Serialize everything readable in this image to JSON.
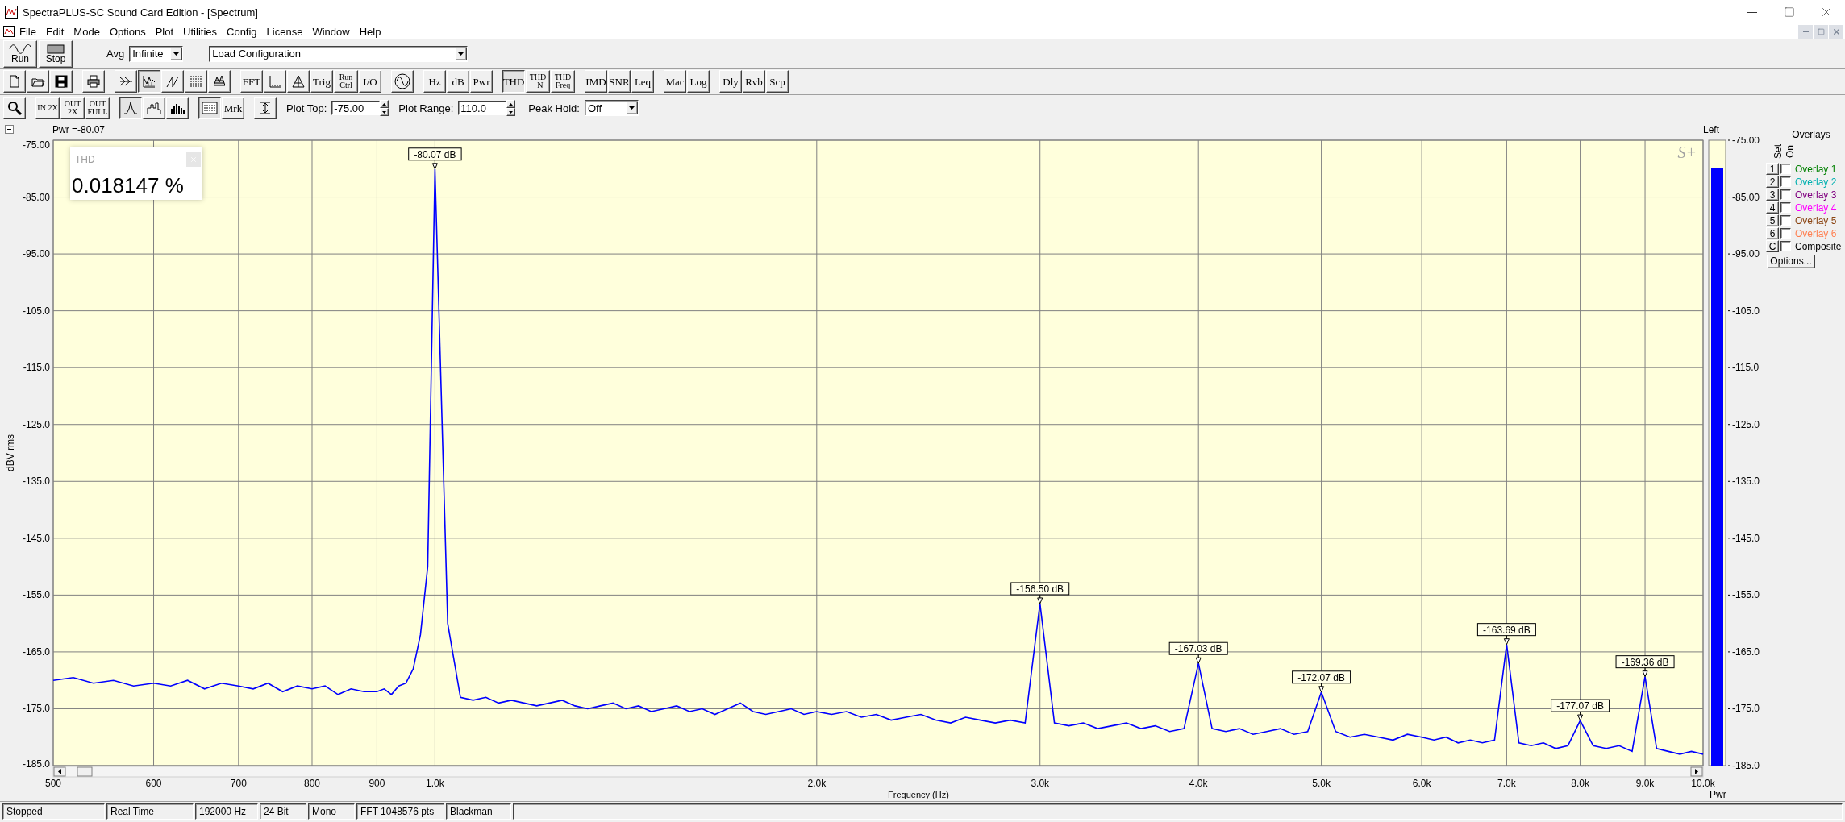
{
  "window": {
    "title": "SpectraPLUS-SC Sound Card Edition - [Spectrum]"
  },
  "menu": [
    "File",
    "Edit",
    "Mode",
    "Options",
    "Plot",
    "Utilities",
    "Config",
    "License",
    "Window",
    "Help"
  ],
  "toolbar_main": {
    "run": "Run",
    "stop": "Stop",
    "avg_label": "Avg",
    "avg_value": "Infinite",
    "config_value": "Load Configuration"
  },
  "toolbar_analysis": [
    [
      {
        "kind": "icon",
        "pressed": false
      },
      {
        "kind": "icon",
        "pressed": false
      },
      {
        "kind": "icon",
        "pressed": false
      }
    ],
    [
      {
        "kind": "icon",
        "pressed": false
      }
    ],
    [
      {
        "kind": "icon",
        "pressed": false
      },
      {
        "kind": "icon",
        "pressed": true
      },
      {
        "kind": "icon",
        "pressed": false
      },
      {
        "kind": "icon",
        "pressed": false
      },
      {
        "kind": "icon",
        "pressed": false
      }
    ],
    [
      {
        "kind": "text",
        "label": "FFT",
        "pressed": false
      },
      {
        "kind": "icon",
        "pressed": false
      },
      {
        "kind": "icon",
        "pressed": false
      },
      {
        "kind": "text",
        "label": "Trig",
        "pressed": false
      },
      {
        "kind": "text",
        "label": "Run Ctrl",
        "pressed": false
      },
      {
        "kind": "text",
        "label": "I/O",
        "pressed": false
      }
    ],
    [
      {
        "kind": "icon",
        "pressed": false
      }
    ],
    [
      {
        "kind": "text",
        "label": "Hz",
        "pressed": false
      },
      {
        "kind": "text",
        "label": "dB",
        "pressed": false
      },
      {
        "kind": "text",
        "label": "Pwr",
        "pressed": false
      }
    ],
    [
      {
        "kind": "text",
        "label": "THD",
        "pressed": true
      },
      {
        "kind": "text",
        "label": "THD +N",
        "pressed": false
      },
      {
        "kind": "text",
        "label": "THD Freq",
        "pressed": false
      }
    ],
    [
      {
        "kind": "text",
        "label": "IMD",
        "pressed": false
      },
      {
        "kind": "text",
        "label": "SNR",
        "pressed": false
      },
      {
        "kind": "text",
        "label": "Leq",
        "pressed": false
      }
    ],
    [
      {
        "kind": "text",
        "label": "Mac",
        "pressed": false
      },
      {
        "kind": "text",
        "label": "Log",
        "pressed": false
      }
    ],
    [
      {
        "kind": "text",
        "label": "Dly",
        "pressed": false
      },
      {
        "kind": "text",
        "label": "Rvb",
        "pressed": false
      },
      {
        "kind": "text",
        "label": "Scp",
        "pressed": false
      }
    ]
  ],
  "toolbar_view": [
    [
      {
        "kind": "icon",
        "pressed": false
      }
    ],
    [
      {
        "kind": "zoom",
        "label": "IN 2X",
        "pressed": false
      },
      {
        "kind": "zoom",
        "label": "OUT 2X",
        "pressed": false
      },
      {
        "kind": "zoom",
        "label": "OUT FULL",
        "pressed": false
      }
    ],
    [
      {
        "kind": "icon",
        "pressed": true
      },
      {
        "kind": "icon",
        "pressed": false
      },
      {
        "kind": "icon",
        "pressed": false
      }
    ],
    [
      {
        "kind": "icon",
        "pressed": true
      },
      {
        "kind": "text",
        "label": "Mrk",
        "pressed": false
      }
    ],
    [
      {
        "kind": "icon",
        "pressed": false
      }
    ]
  ],
  "plot_top": {
    "label": "Plot Top:",
    "value": "-75.00"
  },
  "plot_range": {
    "label": "Plot Range:",
    "value": "110.0"
  },
  "peak_hold": {
    "label": "Peak Hold:",
    "value": "Off"
  },
  "plot": {
    "readout": "Pwr =-80.07",
    "logo": "S+",
    "chart_data": {
      "type": "line",
      "grid": true,
      "xlabel": "Frequency (Hz)",
      "ylabel": "dBV rms",
      "ylim": [
        -185,
        -75
      ],
      "categories": [
        "500",
        null,
        null,
        null,
        null,
        "600",
        null,
        null,
        null,
        null,
        "700",
        null,
        null,
        null,
        null,
        "800",
        null,
        null,
        null,
        null,
        "900",
        null,
        null,
        null,
        null,
        null,
        null,
        null,
        "1.0k",
        null,
        null,
        null,
        null,
        null,
        null,
        null,
        null,
        null,
        null,
        null,
        null,
        null,
        null,
        null,
        null,
        null,
        null,
        null,
        null,
        null,
        null,
        null,
        null,
        null,
        null,
        null,
        null,
        null,
        "2.0k",
        null,
        null,
        null,
        null,
        null,
        null,
        null,
        null,
        null,
        null,
        null,
        null,
        null,
        null,
        "3.0k",
        null,
        null,
        null,
        null,
        null,
        null,
        null,
        null,
        null,
        null,
        "4.0k",
        null,
        null,
        null,
        null,
        null,
        null,
        null,
        null,
        "5.0k",
        null,
        null,
        null,
        null,
        null,
        null,
        "6.0k",
        null,
        null,
        null,
        null,
        null,
        null,
        "7.0k",
        null,
        null,
        null,
        null,
        null,
        "8.0k",
        null,
        null,
        null,
        null,
        "9.0k",
        null,
        null,
        null,
        null,
        "10.0k"
      ],
      "yticks": [
        {
          "value": -75,
          "label": "-75.00"
        },
        {
          "value": -85,
          "label": "-85.00"
        },
        {
          "value": -95,
          "label": "-95.00"
        },
        {
          "value": -105,
          "label": "-105.0"
        },
        {
          "value": -115,
          "label": "-115.0"
        },
        {
          "value": -125,
          "label": "-125.0"
        },
        {
          "value": -135,
          "label": "-135.0"
        },
        {
          "value": -145,
          "label": "-145.0"
        },
        {
          "value": -155,
          "label": "-155.0"
        },
        {
          "value": -165,
          "label": "-165.0"
        },
        {
          "value": -175,
          "label": "-175.0"
        },
        {
          "value": -185,
          "label": "-185.0"
        }
      ],
      "series": [
        {
          "color": "#0000ff",
          "values": [
            -170,
            -169.5,
            -170.5,
            -170,
            -171,
            -170.5,
            -171,
            -170,
            -171.5,
            -170.5,
            -171,
            -171.5,
            -170.5,
            -172,
            -171,
            -171.5,
            -171,
            -172.5,
            -171.5,
            -172,
            -172,
            -171.5,
            -172.5,
            -171,
            -170.5,
            -168,
            -162,
            -150,
            -80.07,
            -160,
            -173,
            -173.5,
            -173,
            -174,
            -173.5,
            -174,
            -174.5,
            -174,
            -173.5,
            -174.5,
            -175,
            -174.5,
            -174,
            -175,
            -174.5,
            -175.5,
            -175,
            -174.5,
            -175.5,
            -175,
            -176,
            -175,
            -174,
            -175.5,
            -176,
            -175.5,
            -175,
            -176,
            -175.5,
            -176,
            -175.5,
            -176.5,
            -176,
            -177,
            -176.5,
            -176,
            -177,
            -177.5,
            -176.5,
            -177,
            -177.5,
            -177,
            -177.5,
            -156.5,
            -177.5,
            -178,
            -177.5,
            -178.5,
            -178,
            -177.5,
            -178.5,
            -178,
            -179,
            -178.5,
            -167.03,
            -178.5,
            -179,
            -178.5,
            -179.5,
            -179,
            -178.5,
            -179.5,
            -179,
            -172.07,
            -179,
            -180,
            -179.5,
            -180,
            -180.5,
            -179.5,
            -180,
            -180.5,
            -180,
            -181,
            -180.5,
            -181,
            -180.5,
            -163.69,
            -181,
            -181.5,
            -181,
            -182,
            -181.5,
            -177.07,
            -181.5,
            -182,
            -181.5,
            -182.5,
            -169.36,
            -182,
            -182.5,
            -183,
            -182.5,
            -183
          ]
        }
      ],
      "annotations": [
        {
          "x": "1.0k",
          "y": -80.07,
          "text": "-80.07 dB"
        },
        {
          "x": "3.0k",
          "y": -156.5,
          "text": "-156.50 dB"
        },
        {
          "x": "4.0k",
          "y": -167.03,
          "text": "-167.03 dB"
        },
        {
          "x": "5.0k",
          "y": -172.07,
          "text": "-172.07 dB"
        },
        {
          "x": "7.0k",
          "y": -163.69,
          "text": "-163.69 dB"
        },
        {
          "x": "8.0k",
          "y": -177.07,
          "text": "-177.07 dB"
        },
        {
          "x": "9.0k",
          "y": -169.36,
          "text": "-169.36 dB"
        }
      ]
    }
  },
  "thd_window": {
    "title": "THD",
    "value": "0.018147 %"
  },
  "meter": {
    "channel": "Left",
    "footer": "Pwr",
    "level": 0.955,
    "ticks": [
      "-75.00",
      "-85.00",
      "-95.00",
      "-105.0",
      "-115.0",
      "-125.0",
      "-135.0",
      "-145.0",
      "-155.0",
      "-165.0",
      "-175.0",
      "-185.0"
    ]
  },
  "overlays": {
    "title": "Overlays",
    "set_heading": "Set",
    "on_heading": "On",
    "options": "Options...",
    "items": [
      {
        "set": "1",
        "label": "Overlay 1",
        "checked": false,
        "color": "#008000"
      },
      {
        "set": "2",
        "label": "Overlay 2",
        "checked": false,
        "color": "#00b0b0"
      },
      {
        "set": "3",
        "label": "Overlay 3",
        "checked": false,
        "color": "#800080"
      },
      {
        "set": "4",
        "label": "Overlay 4",
        "checked": false,
        "color": "#ff00ff"
      },
      {
        "set": "5",
        "label": "Overlay 5",
        "checked": false,
        "color": "#8b4513"
      },
      {
        "set": "6",
        "label": "Overlay 6",
        "checked": false,
        "color": "#ff7f50"
      },
      {
        "set": "C",
        "label": "Composite",
        "checked": false,
        "color": "#000000"
      }
    ]
  },
  "status_bar": [
    "Stopped",
    "Real Time",
    "192000 Hz",
    "24 Bit",
    "Mono",
    "FFT 1048576 pts",
    "Blackman"
  ]
}
